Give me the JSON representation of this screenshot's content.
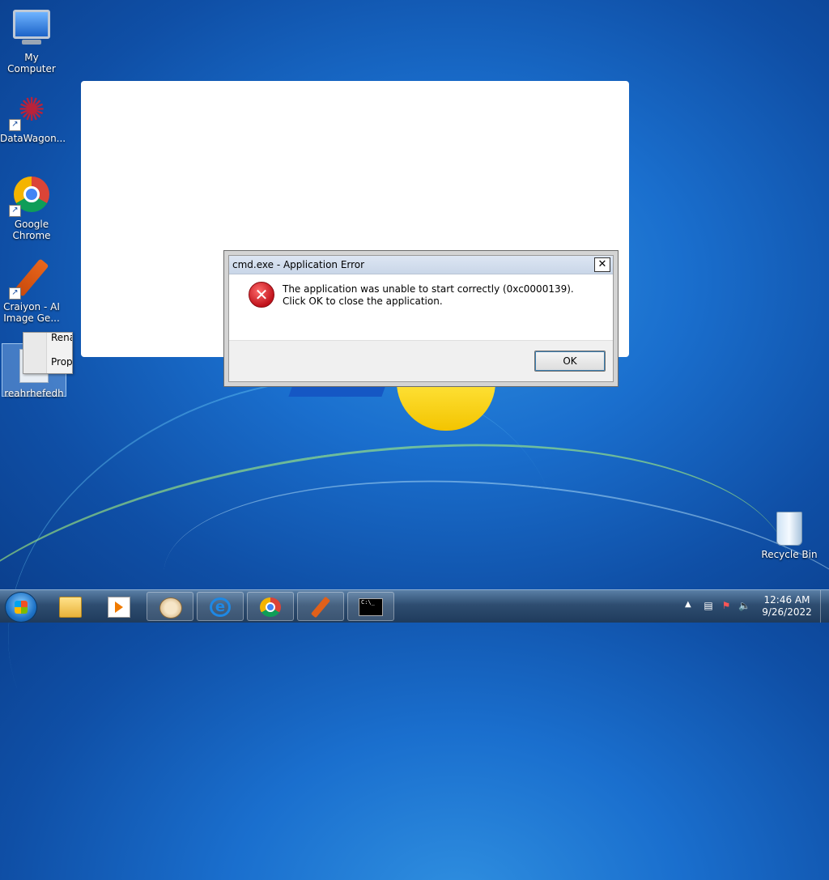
{
  "desktop": {
    "icons": [
      {
        "label": "My Computer"
      },
      {
        "label": "DataWagon..."
      },
      {
        "label": "Google Chrome"
      },
      {
        "label": "Craiyon - AI Image Ge..."
      },
      {
        "label": "reahrhefedh"
      }
    ],
    "recycle_bin": {
      "label": "Recycle Bin"
    }
  },
  "context_menu": {
    "items": [
      "Rena",
      "Prop"
    ]
  },
  "dialog": {
    "title": "cmd.exe - Application Error",
    "close_symbol": "✕",
    "message": "The application was unable to start correctly (0xc0000139). Click OK to close the application.",
    "ok_label": "OK",
    "icon": "error-icon"
  },
  "taskbar": {
    "items": [
      {
        "name": "windows-explorer",
        "icon": "folder-icon"
      },
      {
        "name": "windows-media-player",
        "icon": "media-player-icon"
      },
      {
        "name": "paint",
        "icon": "paint-icon"
      },
      {
        "name": "internet-explorer",
        "icon": "internet-explorer-icon"
      },
      {
        "name": "google-chrome",
        "icon": "chrome-icon"
      },
      {
        "name": "craiyon",
        "icon": "crayon-icon"
      },
      {
        "name": "cmd",
        "icon": "cmd-icon",
        "active": true
      }
    ],
    "cmd_icon_text": "C:\\_",
    "clock": {
      "time": "12:46 AM",
      "date": "9/26/2022"
    }
  },
  "colors": {
    "error_red": "#c0121b",
    "desktop_blue": "#1a6fce",
    "taskbar": "#2e4d70"
  }
}
